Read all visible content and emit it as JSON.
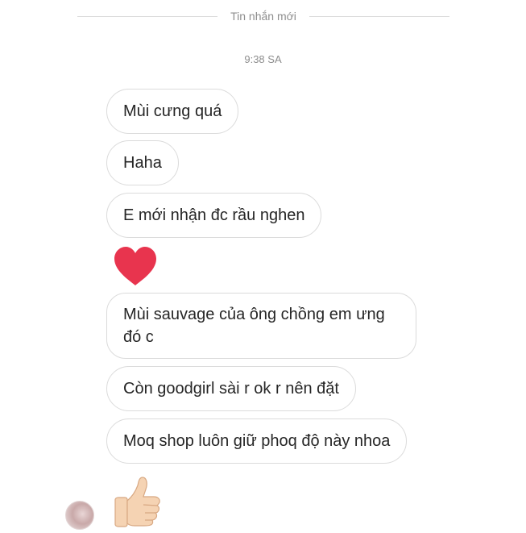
{
  "header": {
    "divider_label": "Tin nhắn mới",
    "timestamp": "9:38 SA"
  },
  "messages": [
    {
      "text": "Mùi cưng quá"
    },
    {
      "text": "Haha"
    },
    {
      "text": "E mới nhận đc rầu nghen"
    },
    {
      "reaction": "heart-icon"
    },
    {
      "text": "Mùi sauvage của ông chồng em ưng đó c"
    },
    {
      "text": "Còn goodgirl sài r ok r nên đặt"
    },
    {
      "text": "Moq shop luôn giữ phoq độ này nhoa"
    },
    {
      "reaction": "thumbs-up-icon"
    }
  ],
  "colors": {
    "heart": "#e8344e",
    "bubble_border": "#dbdbdb",
    "text": "#262626",
    "meta_text": "#8e8e8e"
  }
}
